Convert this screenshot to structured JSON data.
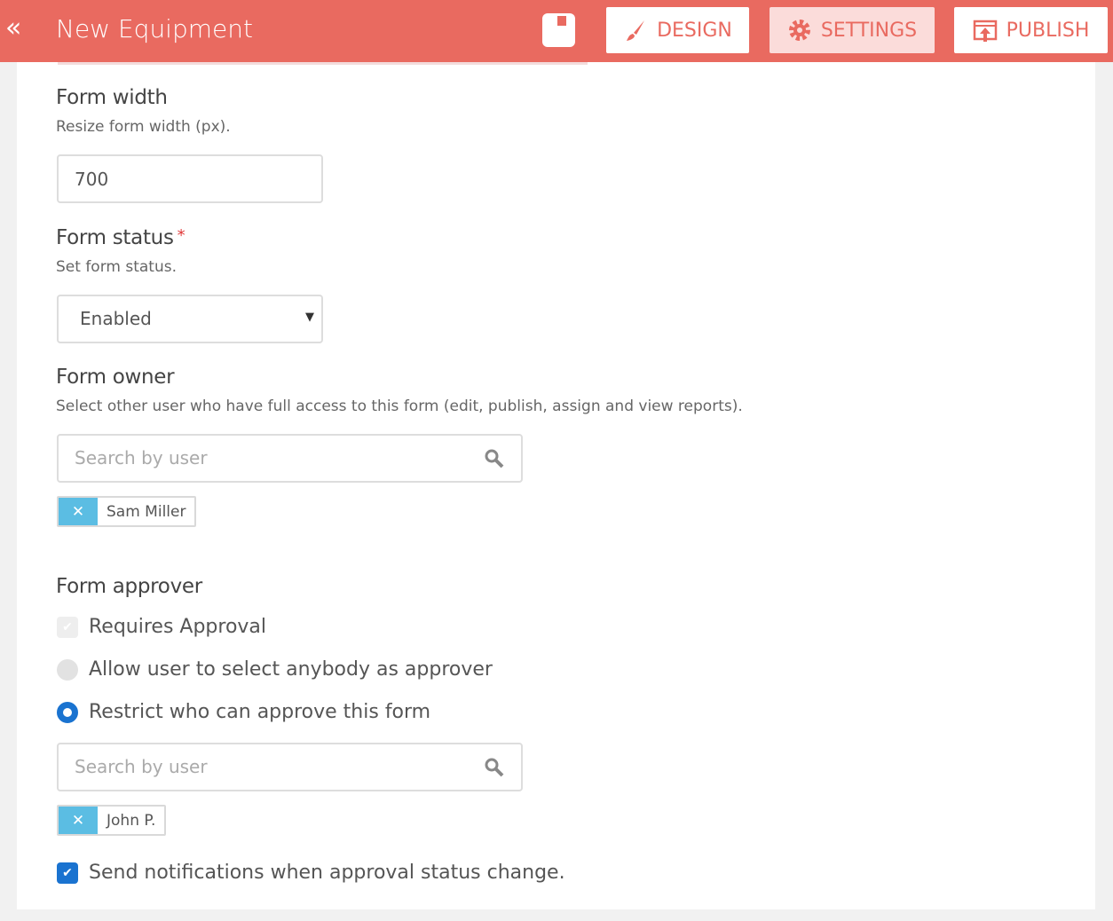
{
  "header": {
    "title": "New Equipment",
    "back_icon": "double-chevron-left",
    "design": "DESIGN",
    "settings": "SETTINGS",
    "publish": "PUBLISH",
    "accent": "#e96a60"
  },
  "form_width": {
    "label": "Form width",
    "help": "Resize form width (px).",
    "value": "700"
  },
  "form_status": {
    "label": "Form status",
    "required": "*",
    "help": "Set form status.",
    "value": "Enabled"
  },
  "form_owner": {
    "label": "Form owner",
    "help": "Select other user who have full access to this form (edit, publish, assign and view reports).",
    "placeholder": "Search by user",
    "tag": "Sam Miller"
  },
  "form_approver": {
    "label": "Form approver",
    "requires": "Requires Approval",
    "allow_any": "Allow user to select anybody as approver",
    "restrict": "Restrict who can approve this form",
    "placeholder": "Search by user",
    "tag": "John P.",
    "notify": "Send notifications when approval status change."
  }
}
